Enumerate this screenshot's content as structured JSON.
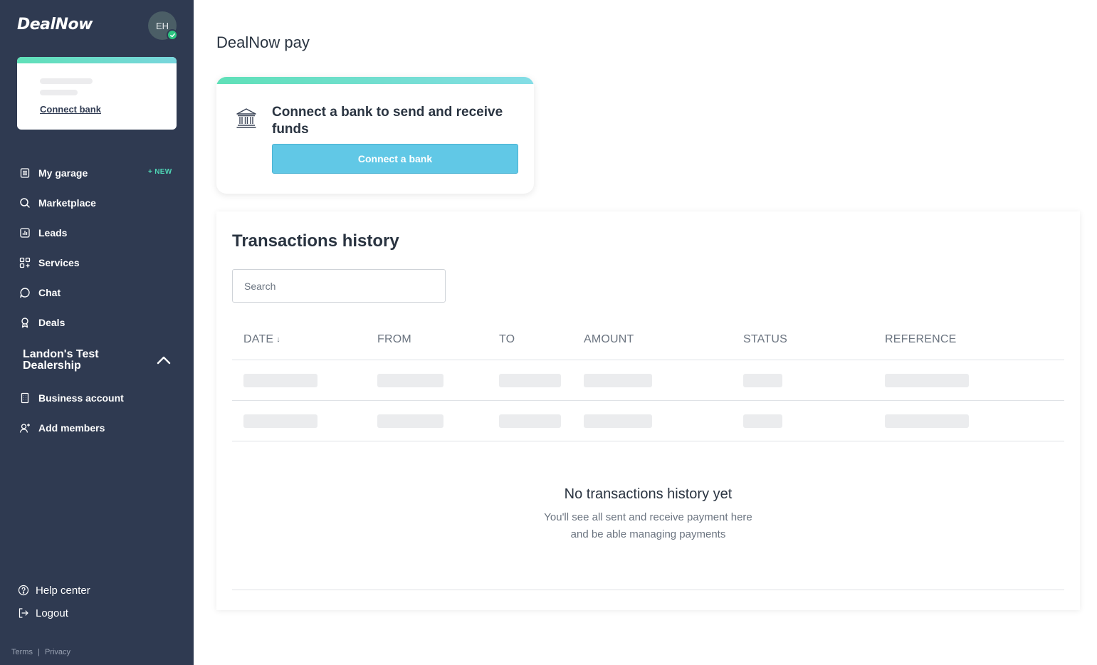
{
  "app": {
    "logo": "DealNow",
    "avatar_initials": "EH"
  },
  "sidebar": {
    "bank_card": {
      "link": "Connect bank"
    },
    "items": [
      {
        "label": "My garage",
        "icon": "list-icon",
        "badge": "+ NEW"
      },
      {
        "label": "Marketplace",
        "icon": "search-icon"
      },
      {
        "label": "Leads",
        "icon": "chart-icon"
      },
      {
        "label": "Services",
        "icon": "grid-icon"
      },
      {
        "label": "Chat",
        "icon": "chat-icon"
      },
      {
        "label": "Deals",
        "icon": "award-icon"
      }
    ],
    "dealership": {
      "name": "Landon's Test Dealership",
      "items": [
        {
          "label": "Business account",
          "icon": "building-icon"
        },
        {
          "label": "Add members",
          "icon": "add-user-icon"
        }
      ]
    },
    "help": "Help center",
    "logout": "Logout",
    "footer": {
      "terms": "Terms",
      "separator": "|",
      "privacy": "Privacy"
    }
  },
  "main": {
    "title": "DealNow pay",
    "connect_card": {
      "heading": "Connect a bank to send and receive funds",
      "button": "Connect a bank"
    },
    "transactions": {
      "title": "Transactions history",
      "search_placeholder": "Search",
      "columns": [
        "DATE",
        "FROM",
        "TO",
        "AMOUNT",
        "STATUS",
        "REFERENCE"
      ],
      "sort_indicator": "↓",
      "empty_title": "No transactions history yet",
      "empty_line1": "You'll see all sent and receive payment here",
      "empty_line2": "and be able managing payments"
    }
  },
  "colors": {
    "sidebar_bg": "#2f3a51",
    "accent_teal": "#4fd6b6",
    "button_blue": "#61c8e6",
    "success_green": "#2dc481"
  }
}
